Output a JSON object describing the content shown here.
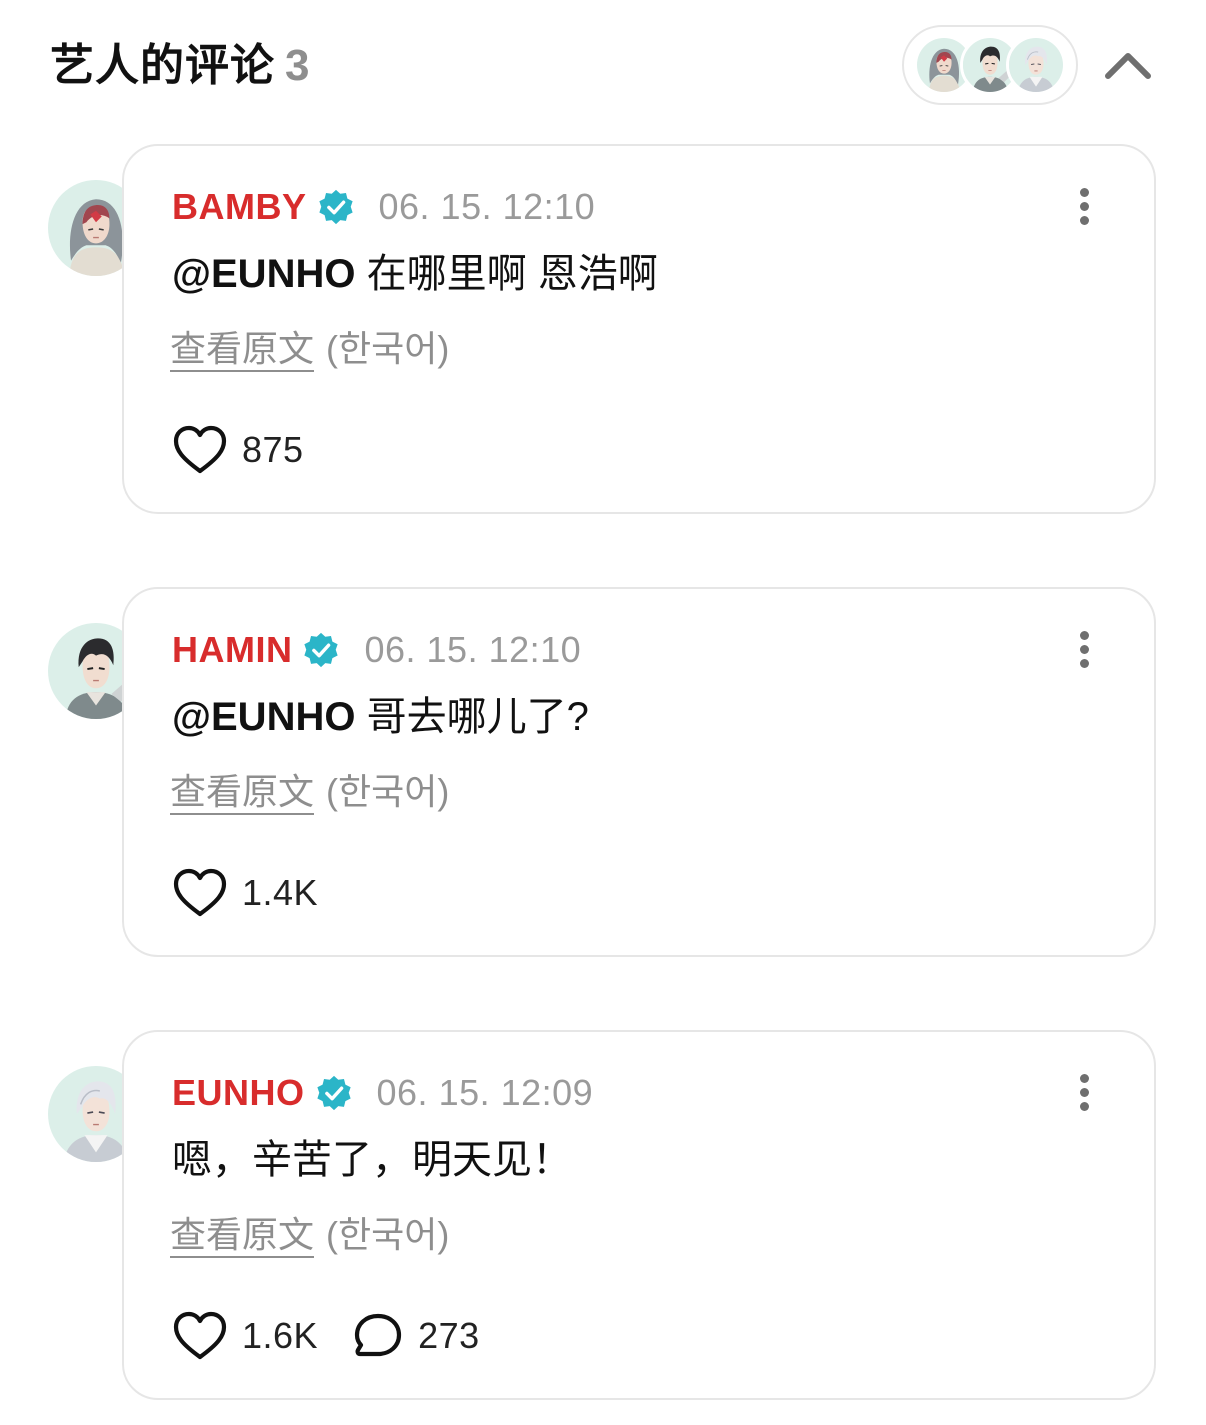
{
  "header": {
    "title": "艺人的评论",
    "count": "3"
  },
  "comments": [
    {
      "author": "BAMBY",
      "time": "06. 15. 12:10",
      "mention": "@EUNHO",
      "text": " 在哪里啊 恩浩啊",
      "view_original": "查看原文",
      "lang": "(한국어)",
      "likes": "875"
    },
    {
      "author": "HAMIN",
      "time": "06. 15. 12:10",
      "mention": "@EUNHO",
      "text": " 哥去哪儿了?",
      "view_original": "查看原文",
      "lang": "(한국어)",
      "likes": "1.4K"
    },
    {
      "author": "EUNHO",
      "time": "06. 15. 12:09",
      "mention": "",
      "text": "嗯，辛苦了，明天见！",
      "view_original": "查看原文",
      "lang": "(한국어)",
      "likes": "1.6K",
      "replies": "273"
    }
  ],
  "colors": {
    "author": "#d82c2c",
    "verified_badge": "#2bb5c8",
    "muted": "#8e8e8e",
    "border": "#e6e6e6"
  },
  "icons": {
    "collapse": "chevron-up-icon",
    "verified": "verified-badge-icon",
    "more": "more-vertical-icon",
    "like": "heart-icon",
    "reply": "comment-bubble-icon"
  }
}
